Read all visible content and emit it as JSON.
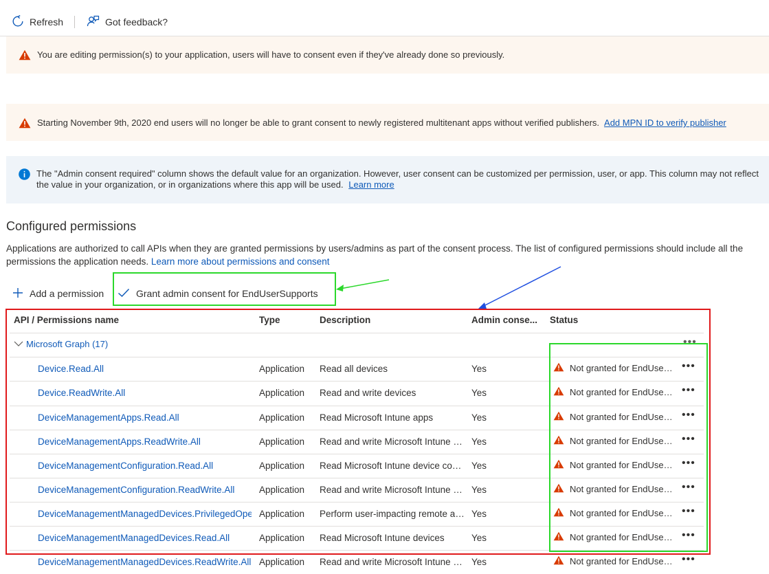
{
  "toolbar": {
    "refresh_label": "Refresh",
    "feedback_label": "Got feedback?"
  },
  "banners": {
    "editing_warning": "You are editing permission(s) to your application, users will have to consent even if they've already done so previously.",
    "publisher_warning": "Starting November 9th, 2020 end users will no longer be able to grant consent to newly registered multitenant apps without verified publishers.",
    "publisher_link": "Add MPN ID to verify publisher",
    "info_text": "The \"Admin consent required\" column shows the default value for an organization. However, user consent can be customized per permission, user, or app. This column may not reflect the value in your organization, or in organizations where this app will be used.",
    "info_link": "Learn more"
  },
  "section": {
    "title": "Configured permissions",
    "description": "Applications are authorized to call APIs when they are granted permissions by users/admins as part of the consent process. The list of configured permissions should include all the permissions the application needs.",
    "description_link": "Learn more about permissions and consent"
  },
  "actions": {
    "add_permission": "Add a permission",
    "grant_consent": "Grant admin consent for EndUserSupports"
  },
  "table": {
    "headers": [
      "API / Permissions name",
      "Type",
      "Description",
      "Admin conse...",
      "Status"
    ],
    "group_label": "Microsoft Graph (17)",
    "rows": [
      {
        "name": "Device.Read.All",
        "type": "Application",
        "description": "Read all devices",
        "admin": "Yes",
        "status": "Not granted for EndUserSupports"
      },
      {
        "name": "Device.ReadWrite.All",
        "type": "Application",
        "description": "Read and write devices",
        "admin": "Yes",
        "status": "Not granted for EndUserSupports"
      },
      {
        "name": "DeviceManagementApps.Read.All",
        "type": "Application",
        "description": "Read Microsoft Intune apps",
        "admin": "Yes",
        "status": "Not granted for EndUserSupports"
      },
      {
        "name": "DeviceManagementApps.ReadWrite.All",
        "type": "Application",
        "description": "Read and write Microsoft Intune apps",
        "admin": "Yes",
        "status": "Not granted for EndUserSupports"
      },
      {
        "name": "DeviceManagementConfiguration.Read.All",
        "type": "Application",
        "description": "Read Microsoft Intune device configuration and policies",
        "admin": "Yes",
        "status": "Not granted for EndUserSupports"
      },
      {
        "name": "DeviceManagementConfiguration.ReadWrite.All",
        "type": "Application",
        "description": "Read and write Microsoft Intune device configuration and policies",
        "admin": "Yes",
        "status": "Not granted for EndUserSupports"
      },
      {
        "name": "DeviceManagementManagedDevices.PrivilegedOperations.All",
        "type": "Application",
        "description": "Perform user-impacting remote actions on Microsoft Intune devices",
        "admin": "Yes",
        "status": "Not granted for EndUserSupports"
      },
      {
        "name": "DeviceManagementManagedDevices.Read.All",
        "type": "Application",
        "description": "Read Microsoft Intune devices",
        "admin": "Yes",
        "status": "Not granted for EndUserSupports"
      },
      {
        "name": "DeviceManagementManagedDevices.ReadWrite.All",
        "type": "Application",
        "description": "Read and write Microsoft Intune devices",
        "admin": "Yes",
        "status": "Not granted for EndUserSupports"
      }
    ],
    "more_label": "•••"
  },
  "colors": {
    "link": "#0f5ab8",
    "warning_icon": "#d83b01",
    "info_icon": "#0078d4",
    "annotation_green": "#2bd82b",
    "annotation_red": "#e0191b",
    "annotation_blue": "#1f4fe0"
  }
}
